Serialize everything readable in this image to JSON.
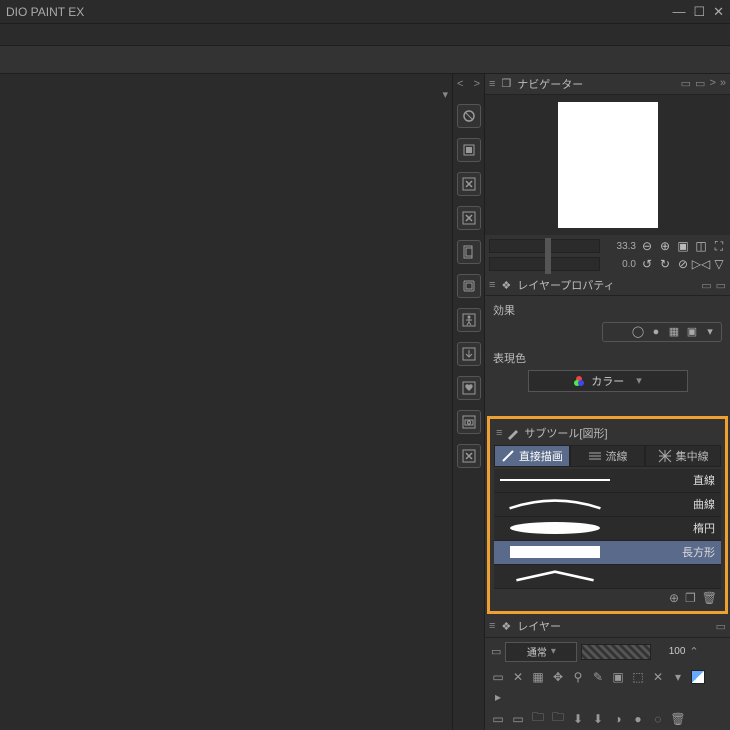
{
  "app": {
    "title": "DIO PAINT EX"
  },
  "window": {
    "min": "—",
    "max": "☐",
    "close": "✕"
  },
  "tab": {
    "label": ""
  },
  "rstrip": {
    "chev_left": "<",
    "chev_right": ">"
  },
  "navigator": {
    "title": "ナビゲーター",
    "zoom": "33.3",
    "rot": "0.0"
  },
  "layer_prop": {
    "title": "レイヤープロパティ",
    "group_effect": "効果",
    "group_color": "表現色",
    "color_value": "カラー"
  },
  "subtool": {
    "title": "サブツール[図形]",
    "tabs": {
      "direct": "直接描画",
      "stream": "流線",
      "focus": "集中線"
    },
    "items": {
      "straight": "直線",
      "curve": "曲線",
      "ellipse": "楕円",
      "rect": "長方形"
    }
  },
  "layer": {
    "title": "レイヤー",
    "mode": "通常",
    "opacity": "100"
  }
}
